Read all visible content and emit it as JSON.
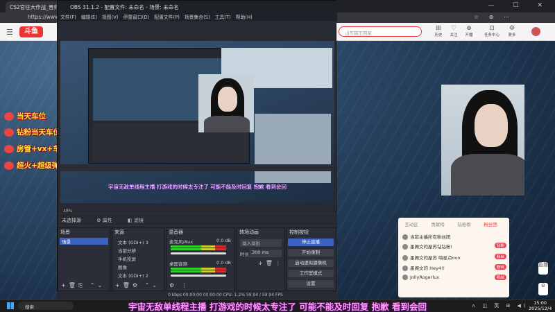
{
  "browser": {
    "tab_title": "CS2官往大作战_晋师次元",
    "url": "https://www.d",
    "window_controls": "— ☐ ✕"
  },
  "site": {
    "logo_text": "斗鱼",
    "search_placeholder": "山东猫王回家",
    "nav": [
      {
        "icon": "⊞",
        "label": "历史"
      },
      {
        "icon": "♡",
        "label": "关注"
      },
      {
        "icon": "⊕",
        "label": "开播"
      },
      {
        "icon": "⊡",
        "label": "任务中心"
      },
      {
        "icon": "⚙",
        "label": "更多"
      }
    ],
    "banners": [
      "当天车位",
      "钻粉当天车位+钻粉群",
      "房管+vx+车位",
      "超火+超级弹幕以上"
    ],
    "side_buttons": [
      "直播",
      "⚙"
    ],
    "chat_tabs": [
      "互动区",
      "贡献榜",
      "钻粉榜",
      "粉丝团"
    ],
    "chat_rows": [
      {
        "user": "玉帝",
        "text": "当前主播所有粉丝团",
        "badge": ""
      },
      {
        "user": "墨阁文的屋苏钻",
        "text": "墨阁文的屋苏钻钻粉!",
        "badge": "钻粉"
      },
      {
        "user": "墨阁文的屋苏",
        "text": "嗨星点ovo",
        "badge": "粉丝"
      },
      {
        "user": "墨阁文的",
        "text": "Hey4!!",
        "badge": "粉丝"
      },
      {
        "user": "JollyRoger",
        "text": "lux",
        "badge": "粉丝"
      }
    ]
  },
  "obs": {
    "title": "OBS 31.1.2 - 配置文件: 未命名 - 场景: 未命名",
    "menu": [
      "文件(F)",
      "编辑(E)",
      "视图(V)",
      "停靠窗口(D)",
      "配置文件(P)",
      "场景集合(S)",
      "工具(T)",
      "帮助(H)"
    ],
    "preview_subtitle": "宇宙无敌单线程主播 打游戏的时候太专注了 可能不能及时回复 抱歉 看到会回",
    "zoom": "48%",
    "source_status": "未选择源",
    "properties_btn": "属性",
    "filters_btn": "滤镜",
    "docks": {
      "scenes": "场景",
      "sources": "来源",
      "mixer": "混音器",
      "transitions": "转场动画",
      "controls": "控制按钮"
    },
    "scene_items": [
      "场景"
    ],
    "source_items": [
      "文本 (GDI+) 3",
      "当前分辨",
      "手机投屏",
      "图像",
      "文本 (GDI+) 2"
    ],
    "mixer_items": [
      {
        "name": "麦克风/Aux",
        "db": "0.0 dB"
      },
      {
        "name": "桌面音频",
        "db": "0.0 dB"
      }
    ],
    "transition_type": "淡入淡出",
    "duration_label": "时长",
    "duration_value": "300 ms",
    "control_buttons": [
      "停止直播",
      "开始录制",
      "启动虚拟摄像机",
      "工作室模式",
      "设置"
    ],
    "bottom_status": "0 kbps   00:00:00   00:00:00   CPU: 1.2%   59.94 / 59.94 FPS"
  },
  "taskbar": {
    "search_placeholder": "搜索",
    "tray": "∧ ◫ 英 ⊞ ◀)",
    "time": "15:00",
    "date": "2025/12/4"
  },
  "overlay_subtitle": "宇宙无敌单线程主播 打游戏的时候太专注了 可能不能及时回复 抱歉 看到会回"
}
